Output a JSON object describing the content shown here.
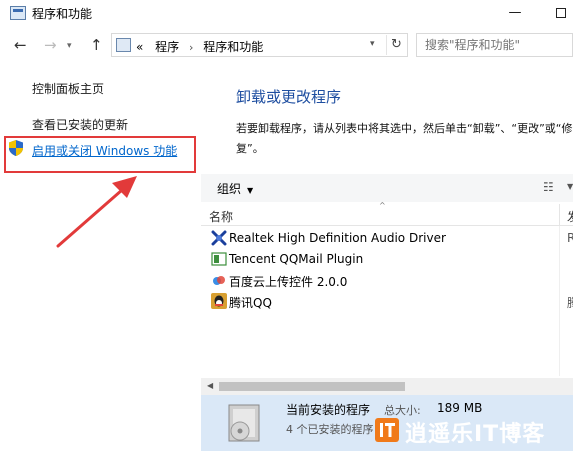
{
  "window": {
    "title": "程序和功能",
    "min_glyph": "—"
  },
  "nav": {
    "back": "←",
    "forward": "→",
    "dropdown": "▾",
    "up": "↑",
    "address": {
      "prefix": "«",
      "crumbs": [
        "程序",
        "程序和功能"
      ],
      "separator": "›",
      "dropdown": "▾",
      "refresh": "↻"
    },
    "search_placeholder": "搜索\"程序和功能\""
  },
  "sidebar": {
    "home": "控制面板主页",
    "updates": "查看已安装的更新",
    "features": "启用或关闭 Windows 功能"
  },
  "main": {
    "title": "卸载或更改程序",
    "description": "若要卸载程序，请从列表中将其选中，然后单击“卸载”、“更改”或“修复”。"
  },
  "toolbar": {
    "organize": "组织",
    "caret": "▼",
    "view": "☷",
    "view_caret": "▼"
  },
  "list": {
    "columns": {
      "name": "名称",
      "sort_glyph": "^",
      "publisher_clip": "发"
    },
    "rows": [
      {
        "name": "Realtek High Definition Audio Driver",
        "publisher_clip": "R",
        "icon": "realtek-audio-icon"
      },
      {
        "name": "Tencent QQMail Plugin",
        "publisher_clip": "",
        "icon": "qqmail-icon"
      },
      {
        "name": "百度云上传控件 2.0.0",
        "publisher_clip": "",
        "icon": "baidu-cloud-icon"
      },
      {
        "name": "腾讯QQ",
        "publisher_clip": "腾",
        "icon": "qq-icon"
      }
    ]
  },
  "scrollbar": {
    "left_arrow": "◀"
  },
  "details": {
    "label": "当前安装的程序",
    "size_label": "总大小:",
    "size_value": "189 MB",
    "count": "4 个已安装的程序"
  },
  "watermark": {
    "text": "逍遥乐IT博客"
  },
  "colors": {
    "highlight_border": "#e23a3a",
    "arrow": "#e23a3a",
    "link": "#0066cc",
    "title_blue": "#1e4ea0",
    "details_bg": "#dae8f7"
  }
}
